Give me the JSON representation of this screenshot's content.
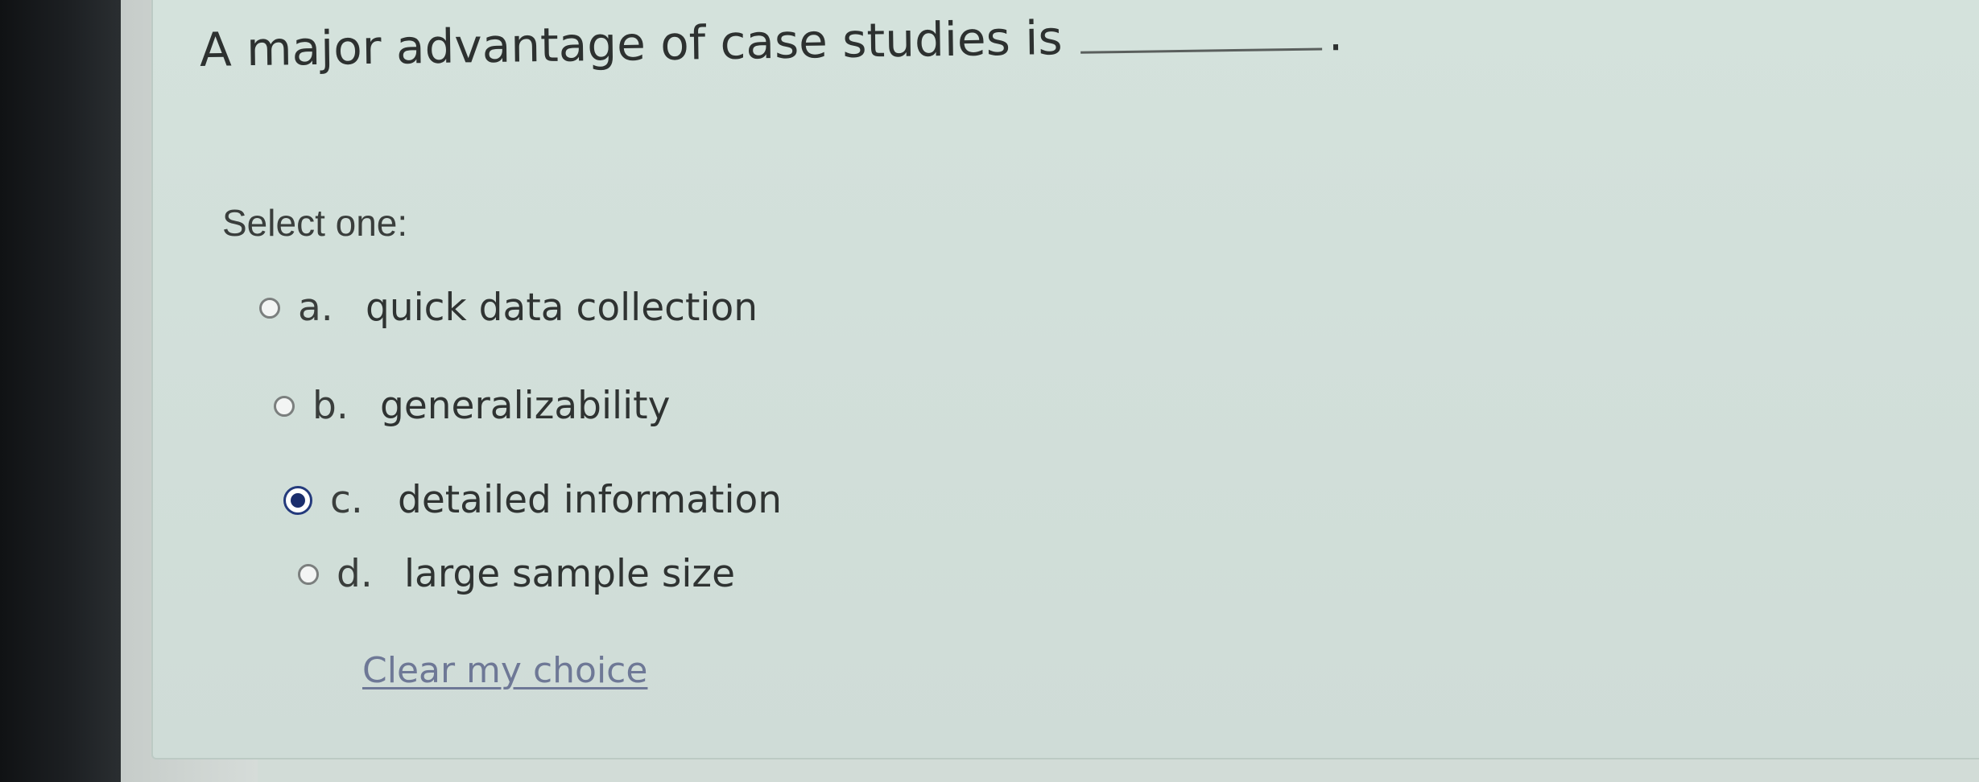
{
  "question": {
    "text": "A major advantage of case studies is",
    "period": "."
  },
  "prompt": "Select one:",
  "options": [
    {
      "letter": "a.",
      "text": "quick data collection",
      "selected": false
    },
    {
      "letter": "b.",
      "text": "generalizability",
      "selected": false
    },
    {
      "letter": "c.",
      "text": "detailed information",
      "selected": true
    },
    {
      "letter": "d.",
      "text": "large sample size",
      "selected": false
    }
  ],
  "clear_link": "Clear my choice"
}
